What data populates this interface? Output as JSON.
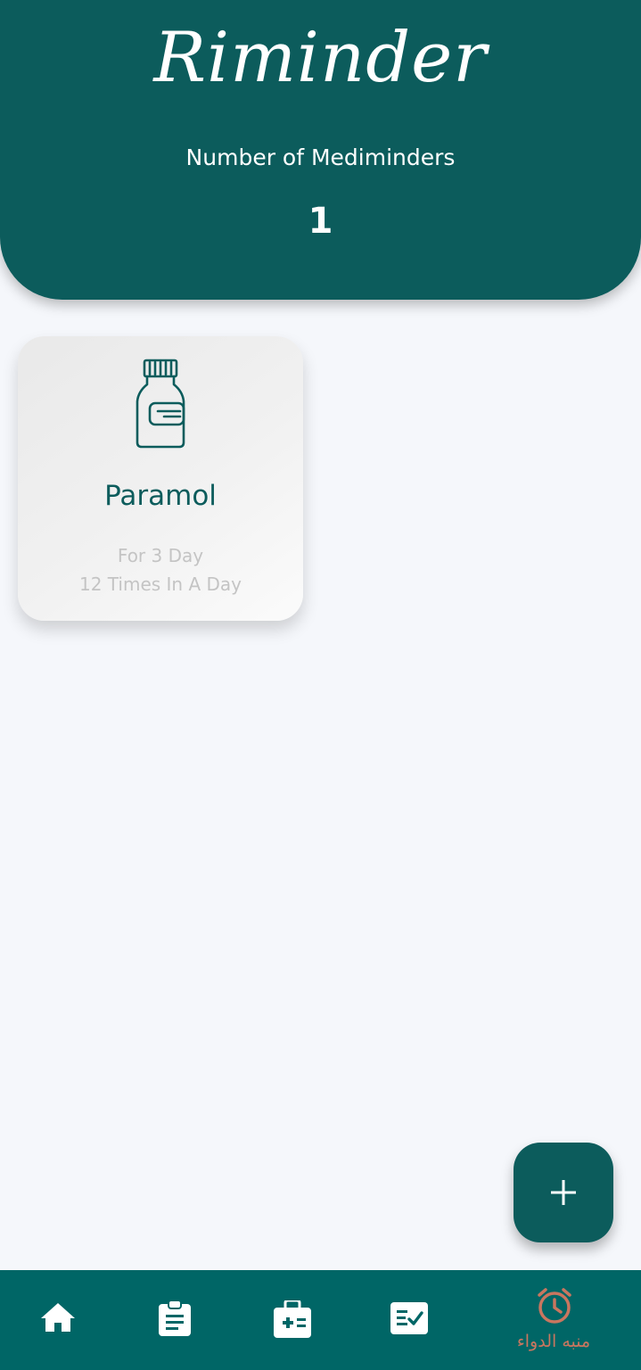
{
  "header": {
    "title": "Riminder",
    "count_label": "Number of Mediminders",
    "count_value": "1"
  },
  "medications": [
    {
      "name": "Paramol",
      "duration": "For 3 Day",
      "frequency": "12 Times In A Day",
      "icon": "medicine-bottle-icon"
    }
  ],
  "fab": {
    "icon": "plus-icon"
  },
  "bottom_nav": {
    "items": [
      {
        "icon": "home-icon"
      },
      {
        "icon": "clipboard-icon"
      },
      {
        "icon": "medical-kit-icon"
      },
      {
        "icon": "checklist-icon"
      },
      {
        "icon": "alarm-clock-icon",
        "label": "منبه الدواء",
        "active": true
      }
    ]
  },
  "colors": {
    "primary": "#0c5c5c",
    "nav_background": "#006666",
    "active_nav": "#c9765f",
    "background": "#f5f7fb",
    "muted_text": "#c4c4c4"
  }
}
